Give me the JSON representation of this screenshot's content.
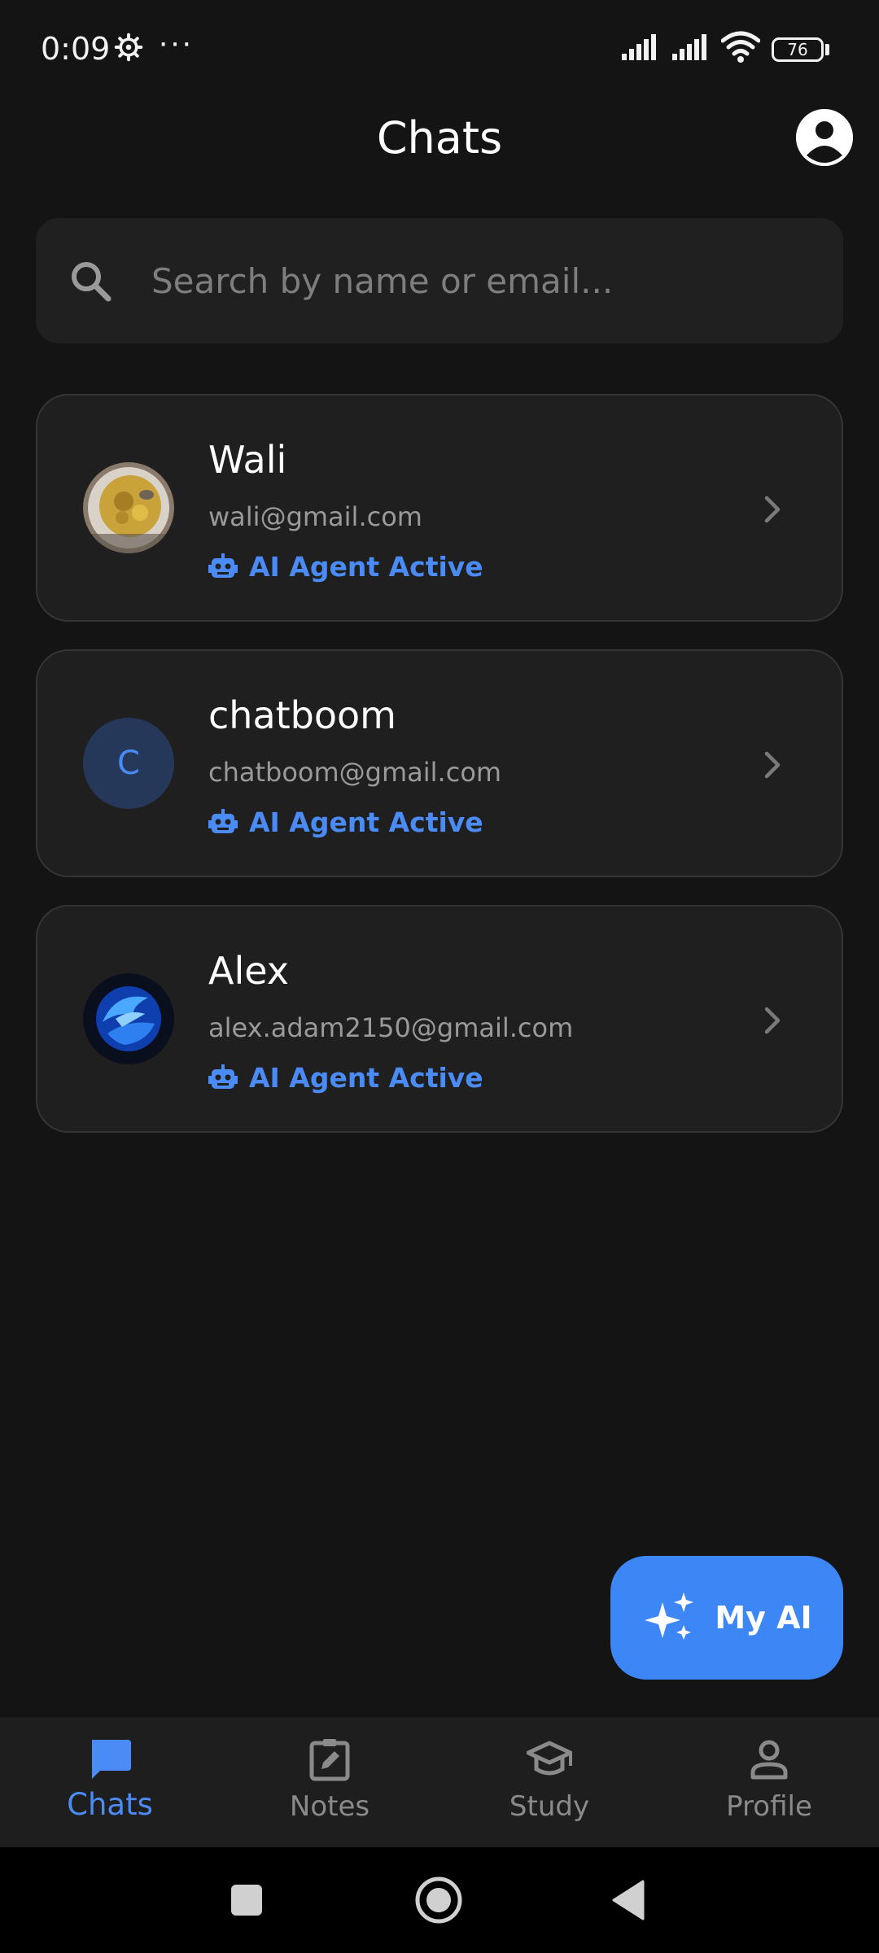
{
  "status_bar": {
    "time": "0:09",
    "dots": "···",
    "battery": "76"
  },
  "header": {
    "title": "Chats"
  },
  "search": {
    "placeholder": "Search by name or email..."
  },
  "chats": [
    {
      "name": "Wali",
      "email": "wali@gmail.com",
      "status": "AI Agent Active",
      "avatar_type": "photo"
    },
    {
      "name": "chatboom",
      "email": "chatboom@gmail.com",
      "status": "AI Agent Active",
      "avatar_type": "initial",
      "initial": "C"
    },
    {
      "name": "Alex",
      "email": "alex.adam2150@gmail.com",
      "status": "AI Agent Active",
      "avatar_type": "logo"
    }
  ],
  "fab": {
    "label": "My AI"
  },
  "bottom_nav": {
    "items": [
      {
        "label": "Chats",
        "icon": "chat-icon",
        "active": true
      },
      {
        "label": "Notes",
        "icon": "notes-icon",
        "active": false
      },
      {
        "label": "Study",
        "icon": "study-icon",
        "active": false
      },
      {
        "label": "Profile",
        "icon": "profile-icon",
        "active": false
      }
    ]
  },
  "colors": {
    "background": "#141414",
    "card": "#1f1f1f",
    "accent": "#4a8bf5",
    "fab": "#3d86f5"
  }
}
